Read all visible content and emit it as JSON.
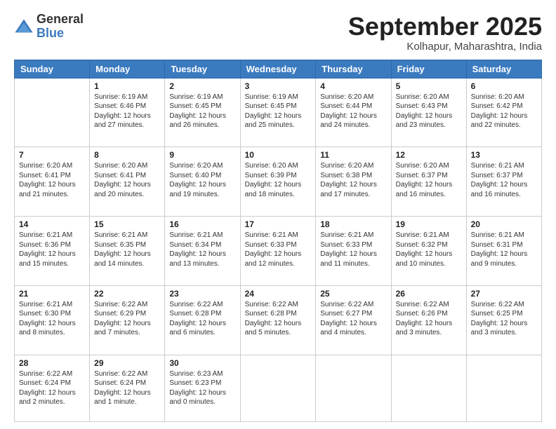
{
  "header": {
    "logo_general": "General",
    "logo_blue": "Blue",
    "month_title": "September 2025",
    "location": "Kolhapur, Maharashtra, India"
  },
  "weekdays": [
    "Sunday",
    "Monday",
    "Tuesday",
    "Wednesday",
    "Thursday",
    "Friday",
    "Saturday"
  ],
  "days": [
    {
      "date": "",
      "info": ""
    },
    {
      "date": "1",
      "info": "Sunrise: 6:19 AM\nSunset: 6:46 PM\nDaylight: 12 hours\nand 27 minutes."
    },
    {
      "date": "2",
      "info": "Sunrise: 6:19 AM\nSunset: 6:45 PM\nDaylight: 12 hours\nand 26 minutes."
    },
    {
      "date": "3",
      "info": "Sunrise: 6:19 AM\nSunset: 6:45 PM\nDaylight: 12 hours\nand 25 minutes."
    },
    {
      "date": "4",
      "info": "Sunrise: 6:20 AM\nSunset: 6:44 PM\nDaylight: 12 hours\nand 24 minutes."
    },
    {
      "date": "5",
      "info": "Sunrise: 6:20 AM\nSunset: 6:43 PM\nDaylight: 12 hours\nand 23 minutes."
    },
    {
      "date": "6",
      "info": "Sunrise: 6:20 AM\nSunset: 6:42 PM\nDaylight: 12 hours\nand 22 minutes."
    },
    {
      "date": "7",
      "info": ""
    },
    {
      "date": "8",
      "info": "Sunrise: 6:20 AM\nSunset: 6:41 PM\nDaylight: 12 hours\nand 20 minutes."
    },
    {
      "date": "9",
      "info": "Sunrise: 6:20 AM\nSunset: 6:40 PM\nDaylight: 12 hours\nand 19 minutes."
    },
    {
      "date": "10",
      "info": "Sunrise: 6:20 AM\nSunset: 6:39 PM\nDaylight: 12 hours\nand 18 minutes."
    },
    {
      "date": "11",
      "info": "Sunrise: 6:20 AM\nSunset: 6:38 PM\nDaylight: 12 hours\nand 17 minutes."
    },
    {
      "date": "12",
      "info": "Sunrise: 6:20 AM\nSunset: 6:37 PM\nDaylight: 12 hours\nand 16 minutes."
    },
    {
      "date": "13",
      "info": "Sunrise: 6:21 AM\nSunset: 6:37 PM\nDaylight: 12 hours\nand 16 minutes."
    },
    {
      "date": "14",
      "info": ""
    },
    {
      "date": "15",
      "info": "Sunrise: 6:21 AM\nSunset: 6:35 PM\nDaylight: 12 hours\nand 14 minutes."
    },
    {
      "date": "16",
      "info": "Sunrise: 6:21 AM\nSunset: 6:34 PM\nDaylight: 12 hours\nand 13 minutes."
    },
    {
      "date": "17",
      "info": "Sunrise: 6:21 AM\nSunset: 6:33 PM\nDaylight: 12 hours\nand 12 minutes."
    },
    {
      "date": "18",
      "info": "Sunrise: 6:21 AM\nSunset: 6:33 PM\nDaylight: 12 hours\nand 11 minutes."
    },
    {
      "date": "19",
      "info": "Sunrise: 6:21 AM\nSunset: 6:32 PM\nDaylight: 12 hours\nand 10 minutes."
    },
    {
      "date": "20",
      "info": "Sunrise: 6:21 AM\nSunset: 6:31 PM\nDaylight: 12 hours\nand 9 minutes."
    },
    {
      "date": "21",
      "info": ""
    },
    {
      "date": "22",
      "info": "Sunrise: 6:22 AM\nSunset: 6:29 PM\nDaylight: 12 hours\nand 7 minutes."
    },
    {
      "date": "23",
      "info": "Sunrise: 6:22 AM\nSunset: 6:28 PM\nDaylight: 12 hours\nand 6 minutes."
    },
    {
      "date": "24",
      "info": "Sunrise: 6:22 AM\nSunset: 6:28 PM\nDaylight: 12 hours\nand 5 minutes."
    },
    {
      "date": "25",
      "info": "Sunrise: 6:22 AM\nSunset: 6:27 PM\nDaylight: 12 hours\nand 4 minutes."
    },
    {
      "date": "26",
      "info": "Sunrise: 6:22 AM\nSunset: 6:26 PM\nDaylight: 12 hours\nand 3 minutes."
    },
    {
      "date": "27",
      "info": "Sunrise: 6:22 AM\nSunset: 6:25 PM\nDaylight: 12 hours\nand 3 minutes."
    },
    {
      "date": "28",
      "info": ""
    },
    {
      "date": "29",
      "info": "Sunrise: 6:22 AM\nSunset: 6:24 PM\nDaylight: 12 hours\nand 1 minute."
    },
    {
      "date": "30",
      "info": "Sunrise: 6:23 AM\nSunset: 6:23 PM\nDaylight: 12 hours\nand 0 minutes."
    },
    {
      "date": "",
      "info": ""
    },
    {
      "date": "",
      "info": ""
    },
    {
      "date": "",
      "info": ""
    },
    {
      "date": "",
      "info": ""
    }
  ],
  "row7_sun": {
    "date": "7",
    "info": "Sunrise: 6:20 AM\nSunset: 6:41 PM\nDaylight: 12 hours\nand 21 minutes."
  },
  "row14_sun": {
    "date": "14",
    "info": "Sunrise: 6:21 AM\nSunset: 6:36 PM\nDaylight: 12 hours\nand 15 minutes."
  },
  "row21_sun": {
    "date": "21",
    "info": "Sunrise: 6:21 AM\nSunset: 6:30 PM\nDaylight: 12 hours\nand 8 minutes."
  },
  "row28_sun": {
    "date": "28",
    "info": "Sunrise: 6:22 AM\nSunset: 6:24 PM\nDaylight: 12 hours\nand 2 minutes."
  }
}
